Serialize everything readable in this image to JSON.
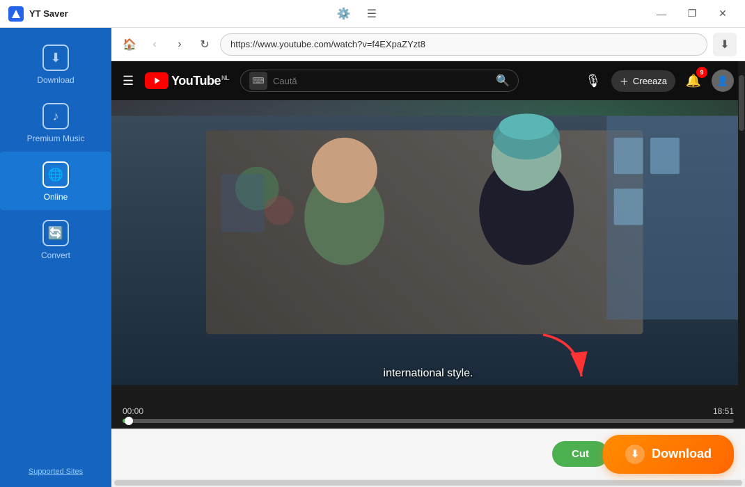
{
  "app": {
    "title": "YT Saver",
    "logo_bg": "#2563eb"
  },
  "titlebar": {
    "settings_tooltip": "Settings",
    "menu_tooltip": "Menu",
    "minimize": "—",
    "maximize": "❐",
    "close": "✕"
  },
  "sidebar": {
    "items": [
      {
        "id": "download",
        "label": "Download",
        "icon": "⬇",
        "active": false
      },
      {
        "id": "premium-music",
        "label": "Premium Music",
        "icon": "♪",
        "active": false
      },
      {
        "id": "online",
        "label": "Online",
        "icon": "🌐",
        "active": true
      },
      {
        "id": "convert",
        "label": "Convert",
        "icon": "🔄",
        "active": false
      }
    ],
    "supported_sites": "Supported Sites"
  },
  "addressbar": {
    "url": "https://www.youtube.com/watch?v=f4EXpaZYzt8",
    "back_title": "Back",
    "forward_title": "Forward",
    "refresh_title": "Refresh",
    "home_title": "Home"
  },
  "youtube": {
    "logo_text": "YouTube",
    "logo_suffix": "NL",
    "search_placeholder": "Caută",
    "create_label": "Creeaza",
    "notification_count": "9",
    "mic_title": "Search by voice",
    "search_title": "Search"
  },
  "video": {
    "subtitle": "international style.",
    "time_current": "00:00",
    "time_total": "18:51",
    "progress_percent": 1
  },
  "controls": {
    "cut_label": "Cut",
    "download_label": "Download"
  }
}
